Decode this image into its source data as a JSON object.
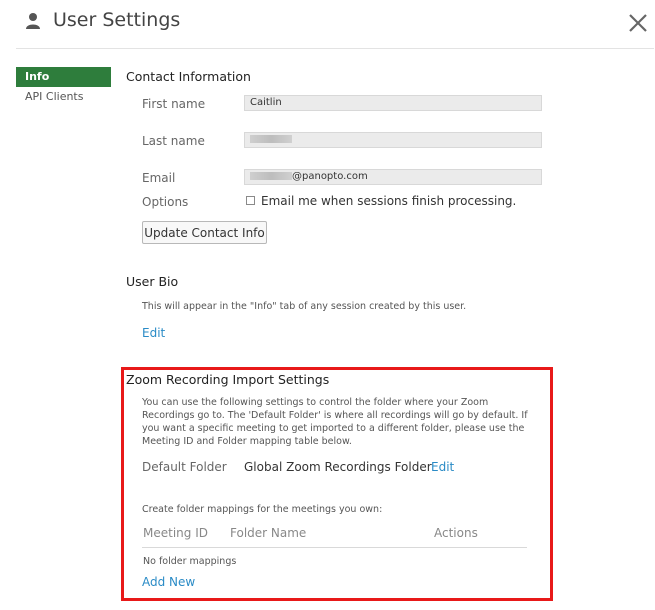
{
  "header": {
    "title": "User Settings",
    "icon": "user-icon",
    "close_icon": "close-icon"
  },
  "sidebar": {
    "items": [
      {
        "label": "Info",
        "active": true
      },
      {
        "label": "API Clients",
        "active": false
      }
    ],
    "active_color": "#2e7d3c"
  },
  "contact": {
    "title": "Contact Information",
    "first_name_label": "First name",
    "first_name_value": "Caitlin",
    "last_name_label": "Last name",
    "email_label": "Email",
    "email_suffix": "@panopto.com",
    "options_label": "Options",
    "email_checkbox_label": "Email me when sessions finish processing.",
    "email_checkbox_checked": false,
    "update_button": "Update Contact Info"
  },
  "bio": {
    "title": "User Bio",
    "description": "This will appear in the \"Info\" tab of any session created by this user.",
    "edit_link": "Edit"
  },
  "zoom": {
    "title": "Zoom Recording Import Settings",
    "description": "You can use the following settings to control the folder where your Zoom Recordings go to. The 'Default Folder' is where all recordings will go by default. If you want a specific meeting to get imported to a different folder, please use the Meeting ID and Folder mapping table below.",
    "default_folder_label": "Default Folder",
    "default_folder_value": "Global Zoom Recordings Folder",
    "edit_link": "Edit",
    "mappings_intro": "Create folder mappings for the meetings you own:",
    "columns": [
      "Meeting ID",
      "Folder Name",
      "Actions"
    ],
    "empty_text": "No folder mappings",
    "add_new_link": "Add New",
    "highlight_color": "#e81919"
  },
  "colors": {
    "link": "#2a8bc6",
    "field_bg": "#ebebeb"
  }
}
